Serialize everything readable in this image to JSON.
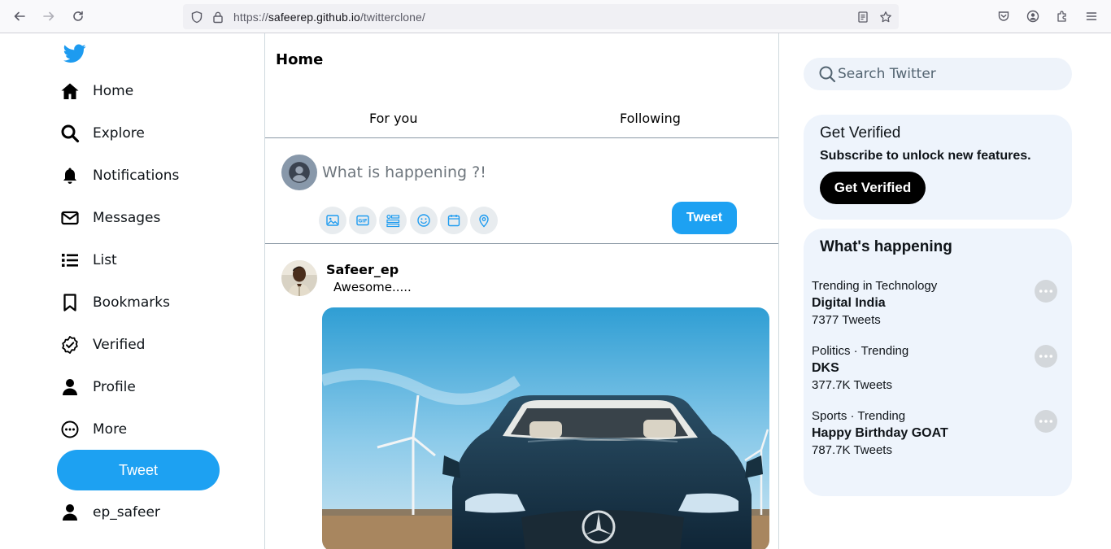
{
  "browser": {
    "url_prefix": "https://",
    "url_host": "safeerep.github.io",
    "url_path": "/twitterclone/"
  },
  "sidebar": {
    "items": [
      {
        "label": "Home",
        "icon": "home-icon"
      },
      {
        "label": "Explore",
        "icon": "search-icon"
      },
      {
        "label": "Notifications",
        "icon": "bell-icon"
      },
      {
        "label": "Messages",
        "icon": "envelope-icon"
      },
      {
        "label": "List",
        "icon": "list-icon"
      },
      {
        "label": "Bookmarks",
        "icon": "bookmark-icon"
      },
      {
        "label": "Verified",
        "icon": "verified-icon"
      },
      {
        "label": "Profile",
        "icon": "user-icon"
      },
      {
        "label": "More",
        "icon": "more-circle-icon"
      }
    ],
    "tweet_label": "Tweet",
    "account_name": "ep_safeer"
  },
  "main": {
    "title": "Home",
    "tabs": [
      {
        "label": "For you"
      },
      {
        "label": "Following"
      }
    ],
    "compose": {
      "placeholder": "What is happening ?!",
      "tweet_label": "Tweet",
      "tools": [
        "image-icon",
        "gif-icon",
        "poll-icon",
        "emoji-icon",
        "schedule-icon",
        "location-icon"
      ]
    },
    "post": {
      "username": "Safeer_ep",
      "text": "Awesome....."
    }
  },
  "right": {
    "search_placeholder": "Search Twitter",
    "verified": {
      "title": "Get Verified",
      "subtitle": "Subscribe to unlock new features.",
      "button": "Get Verified"
    },
    "happening": {
      "title": "What's happening",
      "trends": [
        {
          "category": "Trending in Technology",
          "name": "Digital India",
          "count": "7377 Tweets"
        },
        {
          "category": "Politics · Trending",
          "name": "DKS",
          "count": "377.7K Tweets"
        },
        {
          "category": "Sports · Trending",
          "name": "Happy Birthday GOAT",
          "count": "787.7K Tweets"
        }
      ]
    }
  },
  "colors": {
    "brand": "#1da1f2",
    "card_bg": "#eef4fc",
    "text": "#0f1419"
  }
}
